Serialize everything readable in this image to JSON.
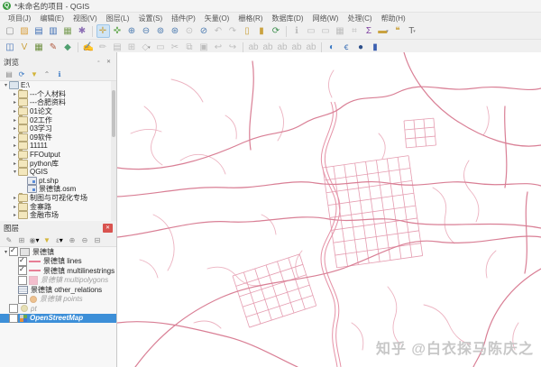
{
  "window": {
    "title": "*未命名的项目 - QGIS",
    "logo_letter": "Q"
  },
  "menubar": {
    "items": [
      {
        "label": "项目(J)"
      },
      {
        "label": "编辑(E)"
      },
      {
        "label": "视图(V)"
      },
      {
        "label": "图层(L)"
      },
      {
        "label": "设置(S)"
      },
      {
        "label": "插件(P)"
      },
      {
        "label": "矢量(O)"
      },
      {
        "label": "栅格(R)"
      },
      {
        "label": "数据库(D)"
      },
      {
        "label": "网络(W)"
      },
      {
        "label": "处理(C)"
      },
      {
        "label": "帮助(H)"
      }
    ]
  },
  "toolbars": {
    "row1": [
      {
        "name": "new-project",
        "g": "▢",
        "c": "#8d8d8d"
      },
      {
        "name": "open-project",
        "g": "▨",
        "c": "#d99f3d"
      },
      {
        "name": "save-project",
        "g": "▤",
        "c": "#3f6fb5"
      },
      {
        "name": "save-project-as",
        "g": "▥",
        "c": "#3f6fb5"
      },
      {
        "name": "new-print-layout",
        "g": "▦",
        "c": "#7b9e57"
      },
      {
        "name": "style-manager",
        "g": "✱",
        "c": "#8d6fb5"
      },
      {
        "type": "sep"
      },
      {
        "name": "pan-map",
        "g": "✛",
        "c": "#caa23f",
        "active": true
      },
      {
        "name": "pan-to-selection",
        "g": "✜",
        "c": "#6fae5c"
      },
      {
        "name": "zoom-in",
        "g": "⊕",
        "c": "#4b7ab0"
      },
      {
        "name": "zoom-out",
        "g": "⊖",
        "c": "#4b7ab0"
      },
      {
        "name": "zoom-native",
        "g": "⊚",
        "c": "#4b7ab0"
      },
      {
        "name": "zoom-full",
        "g": "⊛",
        "c": "#4b7ab0"
      },
      {
        "name": "zoom-to-selection",
        "g": "⊙",
        "disabled": true
      },
      {
        "name": "zoom-to-layer",
        "g": "⊘",
        "c": "#4b7ab0"
      },
      {
        "name": "zoom-last",
        "g": "↶",
        "disabled": true
      },
      {
        "name": "zoom-next",
        "g": "↷",
        "disabled": true
      },
      {
        "name": "new-bookmark",
        "g": "▯",
        "c": "#caa23f"
      },
      {
        "name": "show-bookmarks",
        "g": "▮",
        "c": "#caa23f"
      },
      {
        "name": "refresh-map",
        "g": "⟳",
        "c": "#3f8f4f"
      },
      {
        "type": "sep"
      },
      {
        "name": "identify-features",
        "g": "ℹ",
        "disabled": true
      },
      {
        "name": "select-features",
        "g": "▭",
        "disabled": true
      },
      {
        "name": "deselect-features",
        "g": "▭",
        "disabled": true
      },
      {
        "name": "open-attribute-table",
        "g": "▦",
        "disabled": true
      },
      {
        "name": "field-calculator",
        "g": "⌗",
        "disabled": true
      },
      {
        "name": "statistical-summary",
        "g": "Σ",
        "c": "#7d3fa0"
      },
      {
        "name": "measure",
        "g": "▬",
        "c": "#caa23f",
        "dd": true
      },
      {
        "name": "map-tips",
        "g": "❝",
        "c": "#caa23f"
      },
      {
        "name": "text-annotation",
        "g": "T",
        "c": "#666666",
        "dd": true
      }
    ],
    "row2": [
      {
        "name": "open-data-source-manager",
        "g": "◫",
        "c": "#3f6fb5"
      },
      {
        "name": "add-vector-layer",
        "g": "V",
        "c": "#caa23f"
      },
      {
        "name": "add-raster-layer",
        "g": "▦",
        "c": "#6d8f3f"
      },
      {
        "name": "new-shapefile-layer",
        "g": "✎",
        "c": "#b05a3f"
      },
      {
        "name": "new-geopackage-layer",
        "g": "◆",
        "c": "#4f9f6f"
      },
      {
        "type": "sep"
      },
      {
        "name": "current-edits",
        "g": "✍",
        "disabled": true
      },
      {
        "name": "toggle-editing",
        "g": "✏",
        "disabled": true
      },
      {
        "name": "save-layer-edits",
        "g": "▤",
        "disabled": true
      },
      {
        "name": "add-feature",
        "g": "⊞",
        "disabled": true
      },
      {
        "name": "vertex-tool",
        "g": "◇",
        "disabled": true,
        "dd": true
      },
      {
        "name": "delete-selected",
        "g": "▭",
        "disabled": true
      },
      {
        "name": "cut-features",
        "g": "✂",
        "disabled": true
      },
      {
        "name": "copy-features",
        "g": "⧉",
        "disabled": true
      },
      {
        "name": "paste-features",
        "g": "▣",
        "disabled": true
      },
      {
        "name": "undo",
        "g": "↩",
        "disabled": true
      },
      {
        "name": "redo",
        "g": "↪",
        "disabled": true
      },
      {
        "type": "sep"
      },
      {
        "name": "layer-labeling",
        "g": "ab",
        "disabled": true
      },
      {
        "name": "layer-diagram",
        "g": "ab",
        "disabled": true
      },
      {
        "name": "move-label",
        "g": "ab",
        "disabled": true
      },
      {
        "name": "rotate-label",
        "g": "ab",
        "disabled": true
      },
      {
        "name": "change-label",
        "g": "ab",
        "disabled": true
      },
      {
        "type": "sep"
      },
      {
        "name": "quickmapservices",
        "g": "◐",
        "c": "#3a79c4"
      },
      {
        "name": "python-console",
        "g": "ꞓ",
        "c": "#3a6fb5"
      },
      {
        "name": "osm-place-search",
        "g": "●",
        "c": "#2d4f8a"
      },
      {
        "name": "log-messages",
        "g": "▮",
        "c": "#3a5fb0"
      }
    ]
  },
  "browser_panel": {
    "title": "浏览",
    "window_buttons": [
      {
        "name": "float-panel",
        "g": "▫"
      },
      {
        "name": "close-panel",
        "g": "✕"
      }
    ],
    "toolbar": [
      {
        "name": "add-selected-layers",
        "g": "▤",
        "c": "#888888"
      },
      {
        "name": "refresh-browser",
        "g": "⟳",
        "c": "#3a79c4"
      },
      {
        "name": "filter-browser",
        "g": "▼",
        "c": "#d3b53a"
      },
      {
        "name": "collapse-all",
        "g": "⌃",
        "c": "#888888"
      },
      {
        "name": "properties-widget",
        "g": "ℹ",
        "c": "#3a79c4"
      }
    ],
    "tree": [
      {
        "label": "E:\\",
        "depth": 0,
        "exp": "open",
        "icon": "drive"
      },
      {
        "label": "---个人材料",
        "depth": 1,
        "exp": "closed",
        "icon": "folder"
      },
      {
        "label": "---合肥资料",
        "depth": 1,
        "exp": "closed",
        "icon": "folder"
      },
      {
        "label": "01论文",
        "depth": 1,
        "exp": "closed",
        "icon": "folder"
      },
      {
        "label": "02工作",
        "depth": 1,
        "exp": "closed",
        "icon": "folder"
      },
      {
        "label": "03学习",
        "depth": 1,
        "exp": "closed",
        "icon": "folder"
      },
      {
        "label": "09软件",
        "depth": 1,
        "exp": "closed",
        "icon": "folder"
      },
      {
        "label": "11111",
        "depth": 1,
        "exp": "closed",
        "icon": "folder"
      },
      {
        "label": "FFOutput",
        "depth": 1,
        "exp": "closed",
        "icon": "folder"
      },
      {
        "label": "python库",
        "depth": 1,
        "exp": "closed",
        "icon": "folder"
      },
      {
        "label": "QGIS",
        "depth": 1,
        "exp": "open",
        "icon": "folder"
      },
      {
        "label": "pt.shp",
        "depth": 2,
        "icon": "vector"
      },
      {
        "label": "景德镇.osm",
        "depth": 2,
        "icon": "vector"
      },
      {
        "label": "制图与可视化专场",
        "depth": 1,
        "exp": "closed",
        "icon": "folder"
      },
      {
        "label": "金寨路",
        "depth": 1,
        "exp": "closed",
        "icon": "folder"
      },
      {
        "label": "金融市场",
        "depth": 1,
        "exp": "closed",
        "icon": "folder"
      }
    ]
  },
  "layers_panel": {
    "title": "图层",
    "toolbar": [
      {
        "name": "open-layer-styling",
        "g": "✎",
        "c": "#888888"
      },
      {
        "name": "add-group",
        "g": "⊞",
        "c": "#888888"
      },
      {
        "name": "manage-map-themes",
        "g": "◉",
        "c": "#888888",
        "dd": true
      },
      {
        "name": "filter-legend",
        "g": "▼",
        "c": "#d3b53a"
      },
      {
        "name": "filter-by-expression",
        "g": "ε",
        "c": "#888888",
        "dd": true
      },
      {
        "name": "expand-all",
        "g": "⊕",
        "c": "#888888"
      },
      {
        "name": "collapse-all-layers",
        "g": "⊖",
        "c": "#888888"
      },
      {
        "name": "remove-layer",
        "g": "⊟",
        "c": "#888888"
      }
    ],
    "tree": [
      {
        "label": "景德镇",
        "depth": 0,
        "exp": "open",
        "check": "on",
        "symbol": "group"
      },
      {
        "label": "景德镇 lines",
        "depth": 1,
        "check": "on",
        "symbol": "line"
      },
      {
        "label": "景德镇 multilinestrings",
        "depth": 1,
        "check": "on",
        "symbol": "line"
      },
      {
        "label": "景德镇 multipolygons",
        "depth": 1,
        "check": "off",
        "symbol": "polygon",
        "muted": true
      },
      {
        "label": "景德镇 other_relations",
        "depth": 1,
        "check": null,
        "symbol": "table"
      },
      {
        "label": "景德镇 points",
        "depth": 1,
        "check": "off",
        "symbol": "point",
        "muted": true
      },
      {
        "label": "pt",
        "depth": 0,
        "check": "off",
        "symbol": "point2",
        "muted": true
      },
      {
        "label": "OpenStreetMap",
        "depth": 0,
        "check": "off",
        "symbol": "xyz",
        "selected": true
      }
    ]
  },
  "map": {
    "watermark": "知乎 @白衣探马陈庆之",
    "road_color_major": "#d97f95",
    "road_color_minor": "#ecb3c1",
    "road_color_grid": "#e59cb0",
    "selection_color": "#3d8fd8",
    "close_button_color": "#d9534f"
  }
}
